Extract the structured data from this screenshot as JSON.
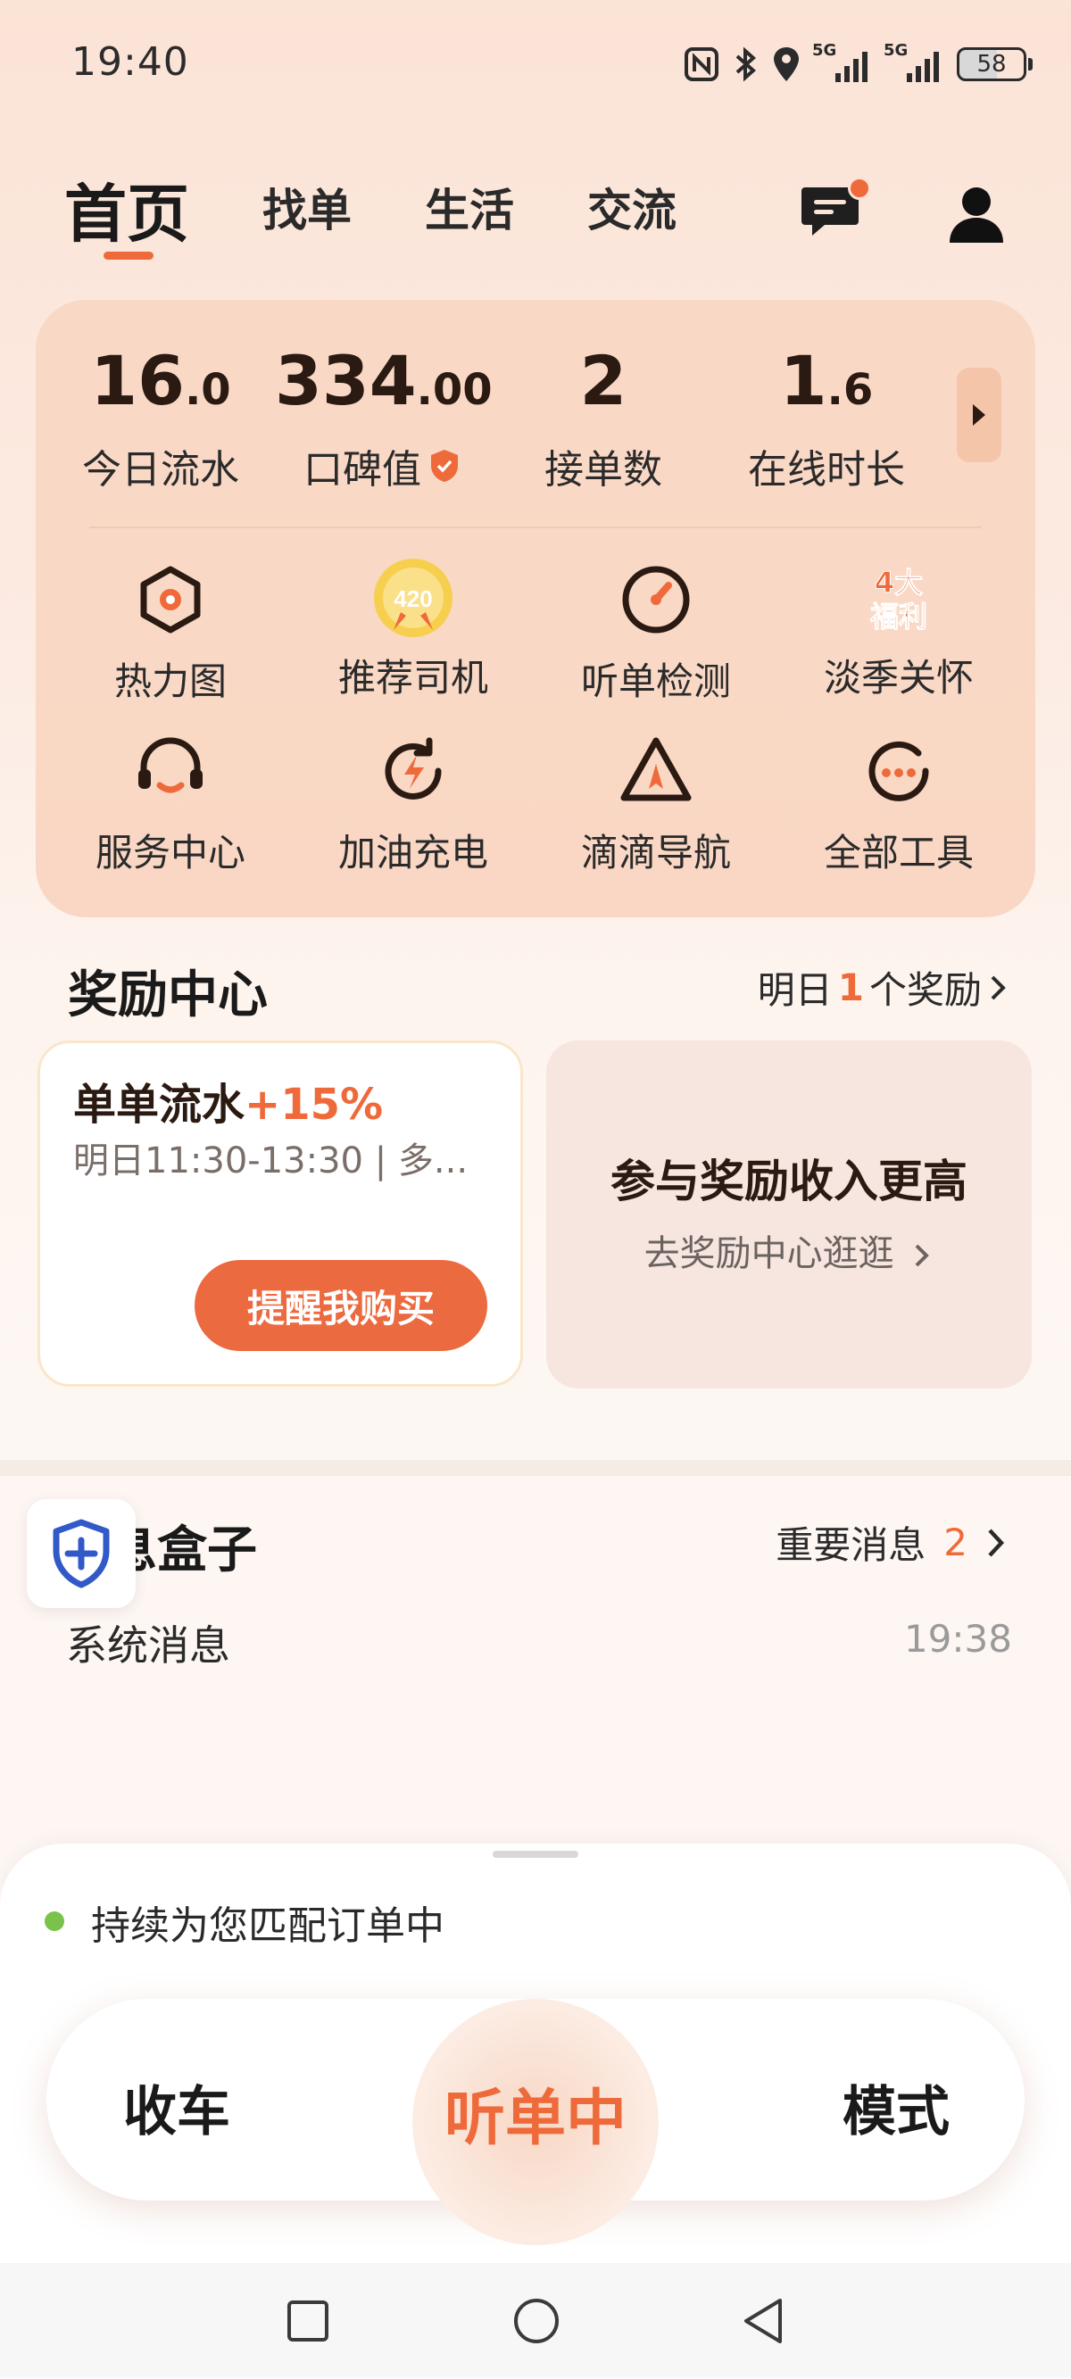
{
  "status_bar": {
    "time": "19:40",
    "net1": "5G",
    "net2": "5G",
    "battery": "58"
  },
  "tabs": [
    {
      "label": "首页",
      "active": true
    },
    {
      "label": "找单"
    },
    {
      "label": "生活"
    },
    {
      "label": "交流"
    }
  ],
  "stats": [
    {
      "value": "16",
      "decimal": ".0",
      "label": "今日流水"
    },
    {
      "value": "334",
      "decimal": ".00",
      "label": "口碑值"
    },
    {
      "value": "2",
      "decimal": "",
      "label": "接单数"
    },
    {
      "value": "1",
      "decimal": ".6",
      "label": "在线时长"
    }
  ],
  "tools": [
    {
      "label": "热力图",
      "icon": "heatmap-icon"
    },
    {
      "label": "推荐司机",
      "icon": "recommend-driver-icon",
      "badge": "420"
    },
    {
      "label": "听单检测",
      "icon": "order-check-icon"
    },
    {
      "label": "淡季关怀",
      "icon": "off-season-care-icon",
      "badge_top": "4大",
      "badge_bottom": "福利"
    },
    {
      "label": "服务中心",
      "icon": "service-center-icon"
    },
    {
      "label": "加油充电",
      "icon": "fuel-charge-icon"
    },
    {
      "label": "滴滴导航",
      "icon": "navigation-icon"
    },
    {
      "label": "全部工具",
      "icon": "all-tools-icon"
    }
  ],
  "rewards": {
    "title": "奖励中心",
    "link_prefix": "明日",
    "link_count": "1",
    "link_suffix": "个奖励",
    "card_left": {
      "title": "单单流水",
      "bonus": "+15%",
      "subtitle": "明日11:30-13:30 | 多...",
      "button": "提醒我购买"
    },
    "card_right": {
      "title": "参与奖励收入更高",
      "subtitle": "去奖励中心逛逛"
    }
  },
  "message_box": {
    "title": "息盒子",
    "important_label": "重要消息",
    "important_count": "2",
    "items": [
      {
        "label": "系统消息",
        "time": "19:38"
      }
    ]
  },
  "bottom": {
    "matching_text": "持续为您匹配订单中",
    "left_button": "收车",
    "center_button": "听单中",
    "right_button": "模式"
  },
  "colors": {
    "accent": "#ef6a3a",
    "online_dot": "#79c24b"
  }
}
